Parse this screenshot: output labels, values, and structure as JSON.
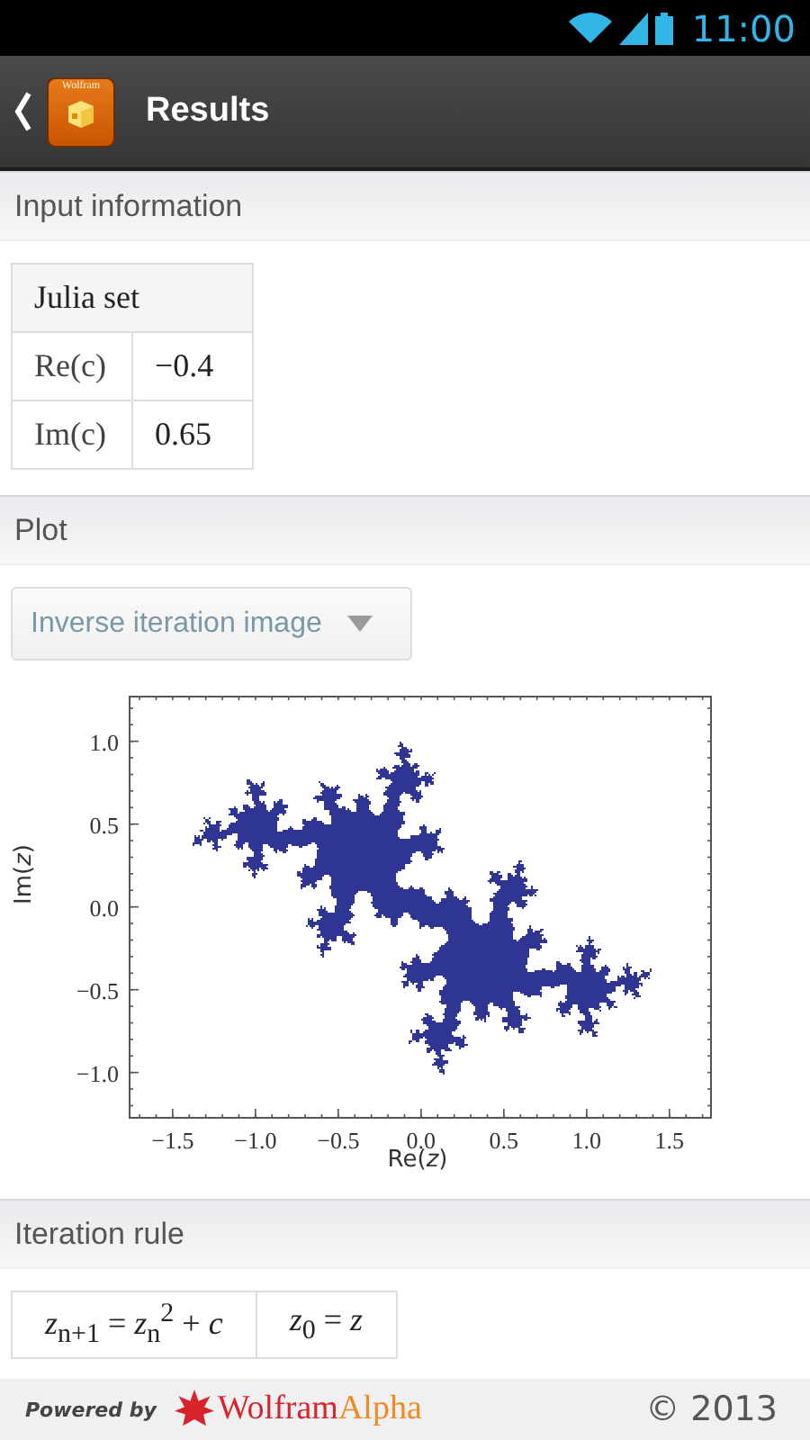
{
  "status_bar": {
    "time": "11:00"
  },
  "action_bar": {
    "app_icon_label": "Wolfram",
    "title": "Results"
  },
  "sections": [
    {
      "kind": "table",
      "title": "Input information",
      "header": "Julia set",
      "rows": [
        [
          "Re(c)",
          "−0.4"
        ],
        [
          "Im(c)",
          "0.65"
        ]
      ]
    },
    {
      "kind": "plot",
      "title": "Plot",
      "dropdown": {
        "value": "Inverse iteration image"
      },
      "plot": {
        "xlabel": "Re(*z*)",
        "ylabel": "Im(*z*)",
        "xticks": [
          "−1.5",
          "−1.0",
          "−0.5",
          "0.0",
          "0.5",
          "1.0",
          "1.5"
        ],
        "yticks": [
          "1.0",
          "0.5",
          "0.0",
          "−0.5",
          "−1.0"
        ]
      }
    },
    {
      "kind": "formula",
      "title": "Iteration rule",
      "cells": [
        "*z*$_{n+1}$ = *z*$_{n}$$^{2}$ + *c*",
        "*z*$_{0}$ = *z*"
      ]
    }
  ],
  "footer": {
    "powered_by": "Powered by",
    "brand": [
      "Wolfram",
      "Alpha"
    ],
    "copyright": "© 2013"
  }
}
